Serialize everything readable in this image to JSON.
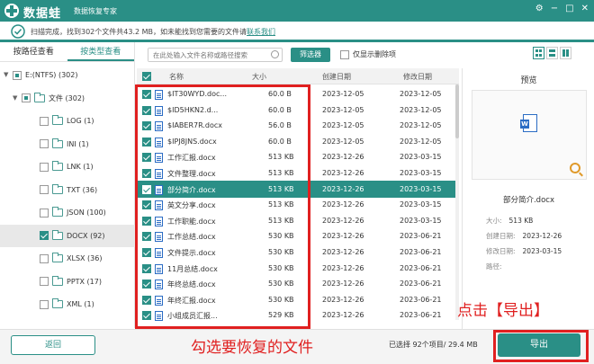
{
  "app": {
    "name": "数据蛙",
    "subtitle": "数据恢复专家",
    "window_controls": [
      "⚙",
      "−",
      "□",
      "✕"
    ]
  },
  "status": {
    "text": "扫描完成，找到302个文件共43.2 MB，如未能找到您需要的文件请",
    "link": "联系我们",
    "progress": 1.0
  },
  "tabs": [
    {
      "label": "按路径查看",
      "active": false
    },
    {
      "label": "按类型查看",
      "active": true
    }
  ],
  "tree": [
    {
      "label": "E:(NTFS) (302)",
      "level": 0,
      "arrow": "▼",
      "check": "part",
      "folder": false
    },
    {
      "label": "文件 (302)",
      "level": 1,
      "arrow": "▼",
      "check": "part",
      "folder": true
    },
    {
      "label": "LOG (1)",
      "level": 2,
      "arrow": "",
      "check": "off",
      "folder": true
    },
    {
      "label": "INI (1)",
      "level": 2,
      "arrow": "",
      "check": "off",
      "folder": true
    },
    {
      "label": "LNK (1)",
      "level": 2,
      "arrow": "",
      "check": "off",
      "folder": true
    },
    {
      "label": "TXT (36)",
      "level": 2,
      "arrow": "",
      "check": "off",
      "folder": true
    },
    {
      "label": "JSON (100)",
      "level": 2,
      "arrow": "",
      "check": "off",
      "folder": true
    },
    {
      "label": "DOCX (92)",
      "level": 2,
      "arrow": "",
      "check": "on",
      "folder": true,
      "selected": true
    },
    {
      "label": "XLSX (36)",
      "level": 2,
      "arrow": "",
      "check": "off",
      "folder": true
    },
    {
      "label": "PPTX (17)",
      "level": 2,
      "arrow": "",
      "check": "off",
      "folder": true
    },
    {
      "label": "XML (1)",
      "level": 2,
      "arrow": "",
      "check": "off",
      "folder": true
    }
  ],
  "toolbar": {
    "search_placeholder": "在此处输入文件名称或路径搜索",
    "filter_label": "筛选器",
    "only_deleted_label": "仅显示删除项"
  },
  "table": {
    "headers": {
      "name": "名称",
      "size": "大小",
      "created": "创建日期",
      "modified": "修改日期"
    },
    "rows": [
      {
        "name": "$IT30WYD.doc...",
        "size": "60.0  B",
        "created": "2023-12-05",
        "modified": "2023-12-05"
      },
      {
        "name": "$ID5HKN2.d...",
        "size": "60.0  B",
        "created": "2023-12-05",
        "modified": "2023-12-05"
      },
      {
        "name": "$IABER7R.docx",
        "size": "56.0  B",
        "created": "2023-12-05",
        "modified": "2023-12-05"
      },
      {
        "name": "$IPJ8JNS.docx",
        "size": "60.0  B",
        "created": "2023-12-05",
        "modified": "2023-12-05"
      },
      {
        "name": "工作汇报.docx",
        "size": "513 KB",
        "created": "2023-12-26",
        "modified": "2023-03-15"
      },
      {
        "name": "文件整理.docx",
        "size": "513 KB",
        "created": "2023-12-26",
        "modified": "2023-03-15"
      },
      {
        "name": "部分简介.docx",
        "size": "513 KB",
        "created": "2023-12-26",
        "modified": "2023-03-15",
        "selected": true
      },
      {
        "name": "英文分享.docx",
        "size": "513 KB",
        "created": "2023-12-26",
        "modified": "2023-03-15"
      },
      {
        "name": "工作职能.docx",
        "size": "513 KB",
        "created": "2023-12-26",
        "modified": "2023-03-15"
      },
      {
        "name": "工作总结.docx",
        "size": "530 KB",
        "created": "2023-12-26",
        "modified": "2023-06-21"
      },
      {
        "name": "文件提示.docx",
        "size": "530 KB",
        "created": "2023-12-26",
        "modified": "2023-06-21"
      },
      {
        "name": "11月总结.docx",
        "size": "530 KB",
        "created": "2023-12-26",
        "modified": "2023-06-21"
      },
      {
        "name": "年终总结.docx",
        "size": "530 KB",
        "created": "2023-12-26",
        "modified": "2023-06-21"
      },
      {
        "name": "年终汇报.docx",
        "size": "530 KB",
        "created": "2023-12-26",
        "modified": "2023-06-21"
      },
      {
        "name": "小组成员汇报...",
        "size": "529 KB",
        "created": "2023-12-26",
        "modified": "2023-06-21"
      }
    ]
  },
  "preview": {
    "title": "预览",
    "doc_badge": "W",
    "file_name": "部分简介.docx",
    "info": [
      {
        "label": "大小:",
        "value": "513 KB"
      },
      {
        "label": "创建日期:",
        "value": "2023-12-26"
      },
      {
        "label": "修改日期:",
        "value": "2023-03-15"
      },
      {
        "label": "路径:",
        "value": ""
      }
    ]
  },
  "bottom": {
    "back_label": "返回",
    "selected_info": "已选择 92个项目/ 29.4 MB",
    "export_label": "导出"
  },
  "annotations": {
    "select_files": "勾选要恢复的文件",
    "click_export": "点击【导出】"
  }
}
